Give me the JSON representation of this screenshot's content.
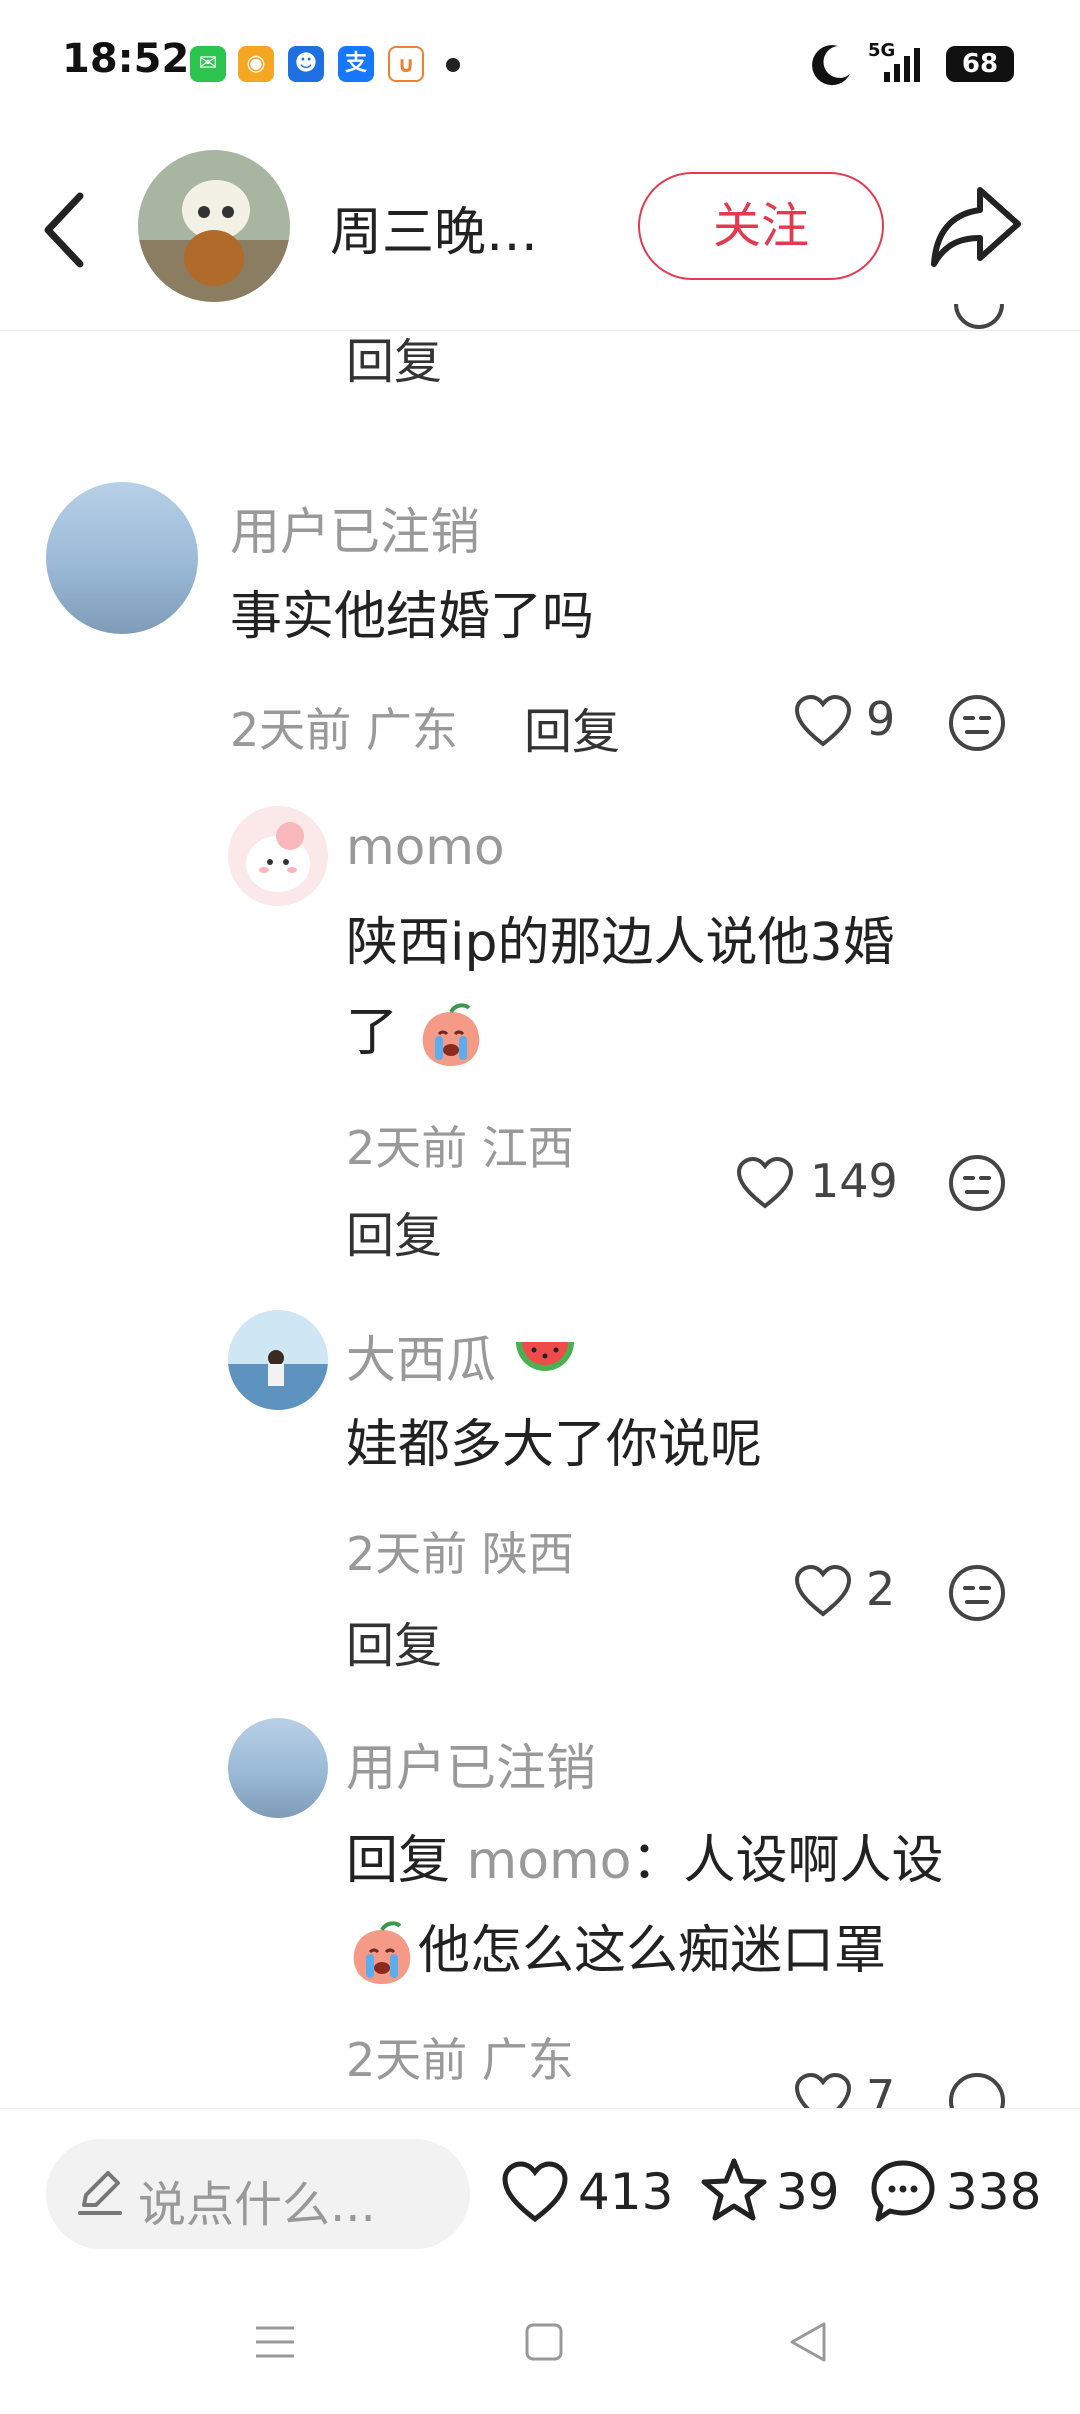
{
  "status": {
    "time": "18:52",
    "network": "5G",
    "battery": "68"
  },
  "header": {
    "name": "周三晚…",
    "follow_label": "关注"
  },
  "top_partial_reply": "回复",
  "comments": [
    {
      "username": "用户已注销",
      "text": "事实他结婚了吗",
      "time": "2天前",
      "location": "广东",
      "reply_label": "回复",
      "likes": "9"
    },
    {
      "username": "momo",
      "text_line1": "陕西ip的那边人说他3婚",
      "text_line2": "了",
      "time": "2天前",
      "location": "江西",
      "reply_label": "回复",
      "likes": "149"
    },
    {
      "username": "大西瓜",
      "text": "娃都多大了你说呢",
      "time": "2天前",
      "location": "陕西",
      "reply_label": "回复",
      "likes": "2"
    },
    {
      "username": "用户已注销",
      "reply_prefix": "回复",
      "reply_target": "momo",
      "text_line1": "：人设啊人设",
      "text_line2": "他怎么这么痴迷口罩",
      "time": "2天前",
      "location": "广东",
      "likes": "7"
    }
  ],
  "bottom": {
    "input_placeholder": "说点什么...",
    "likes": "413",
    "stars": "39",
    "comments": "338"
  },
  "colors": {
    "accent": "#e6394f",
    "muted_text": "#999999"
  },
  "icons": [
    "back-icon",
    "share-icon",
    "heart-icon",
    "dislike-face-icon",
    "edit-pencil-icon",
    "star-icon",
    "comment-bubble-icon",
    "menu-icon",
    "home-square-icon",
    "back-triangle-icon"
  ]
}
